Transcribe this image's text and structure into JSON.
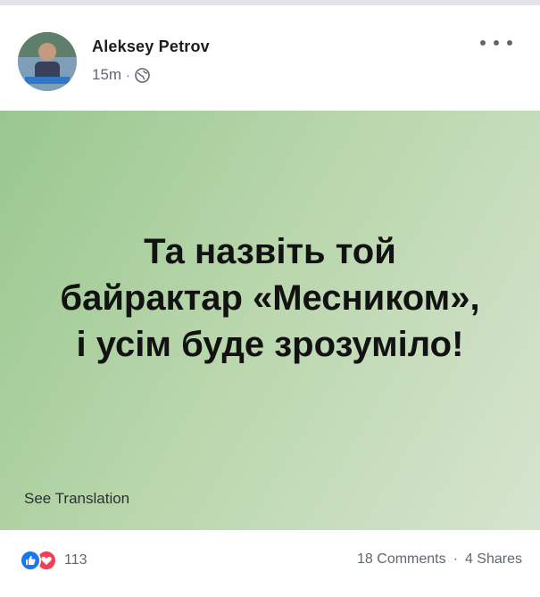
{
  "post": {
    "author": "Aleksey Petrov",
    "time": "15m",
    "privacy_icon": "globe-icon",
    "more_icon": "more-horizontal-icon",
    "background_text": "Та назвіть той\nбайрактар «Месником»,\nі усім буде зрозуміло!",
    "see_translation": "See Translation",
    "reaction_count": "113",
    "comments": "18 Comments",
    "shares": "4 Shares",
    "separator": "·"
  },
  "colors": {
    "like": "#1877f2",
    "love": "#f33e58",
    "background_gradient_start": "#98c78f",
    "background_gradient_end": "#d6e4cf"
  }
}
